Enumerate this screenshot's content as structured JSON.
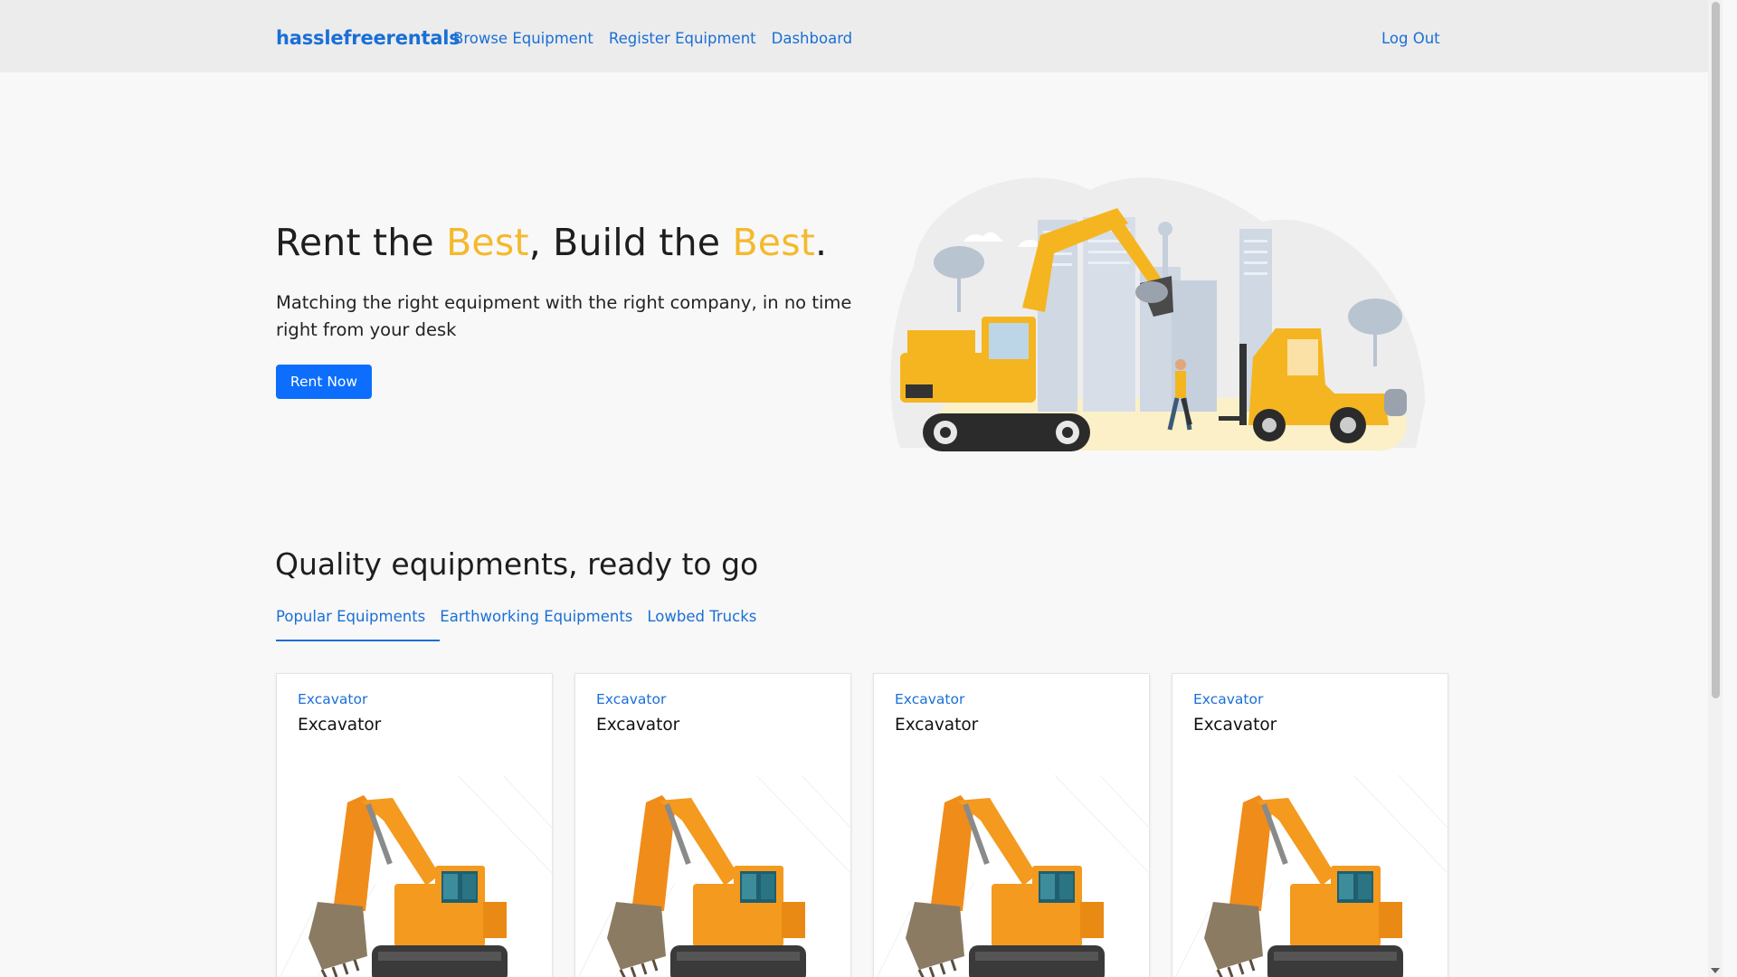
{
  "navbar": {
    "brand": "hasslefreerentals",
    "links": [
      "Browse Equipment",
      "Register Equipment",
      "Dashboard"
    ],
    "logout": "Log Out"
  },
  "hero": {
    "title_parts": [
      "Rent the ",
      "Best",
      ", Build the ",
      "Best",
      "."
    ],
    "subtitle": "Matching the right equipment with the right company, in no time right from your desk",
    "cta": "Rent Now"
  },
  "section": {
    "title": "Quality equipments, ready to go",
    "tabs": [
      "Popular Equipments",
      "Earthworking Equipments",
      "Lowbed Trucks"
    ],
    "active_tab": "Popular Equipments"
  },
  "cards": [
    {
      "category": "Excavator",
      "name": "Excavator",
      "image": "excavator-photo"
    },
    {
      "category": "Excavator",
      "name": "Excavator",
      "image": "excavator-photo"
    },
    {
      "category": "Excavator",
      "name": "Excavator",
      "image": "excavator-photo"
    },
    {
      "category": "Excavator",
      "name": "Excavator",
      "image": "excavator-photo"
    }
  ],
  "colors": {
    "brand_blue": "#1a6fd6",
    "button_blue": "#0d6efd",
    "accent_yellow": "#f4b92c",
    "navbar_bg": "#ececec",
    "page_bg": "#f8f8f8"
  }
}
